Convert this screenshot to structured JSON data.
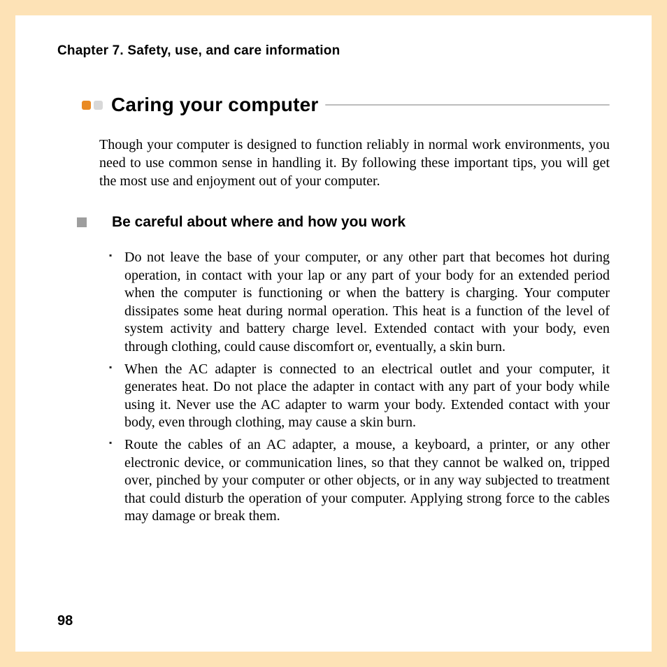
{
  "chapter": "Chapter 7. Safety, use, and care information",
  "section": {
    "title": "Caring your computer",
    "intro": "Though your computer is designed to function reliably in normal work environments, you need to use common sense in handling it. By following these important tips, you will get the most use and enjoyment out of your computer."
  },
  "subsection": {
    "title": "Be careful about where and how you work",
    "items": [
      "Do not leave the base of your computer, or any other part that becomes hot during operation, in contact with your lap or any part of your body for an extended period when the computer is functioning or when the battery is charging. Your computer dissipates some heat during normal operation. This heat is a function of the level of system activity and battery charge level. Extended contact with your body, even through clothing, could cause discomfort or, eventually, a skin burn.",
      "When the AC adapter is connected to an electrical outlet and your computer, it generates heat. Do not place the adapter in contact with any part of your body while using it. Never use the AC adapter to warm your body. Extended contact with your body, even through clothing, may cause a skin burn.",
      "Route the cables of an AC adapter, a mouse, a keyboard, a printer, or any other electronic device, or communication lines, so that they cannot be walked on, tripped over, pinched by your computer or other objects, or in any way subjected to treatment that could disturb the operation of your computer. Applying strong force to the cables may damage or break them."
    ]
  },
  "pageNumber": "98"
}
